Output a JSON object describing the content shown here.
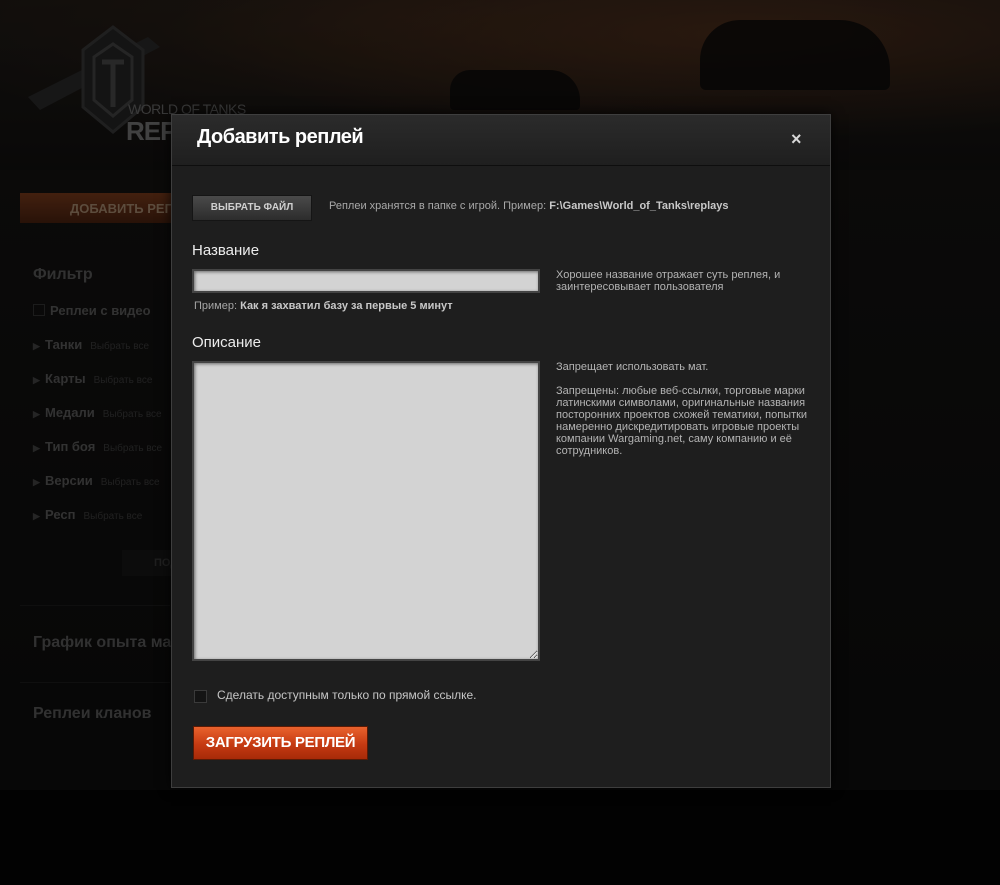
{
  "background": {
    "logo_text": "WORLD OF TANKS",
    "logo_subtitle": "REP",
    "sidebar": {
      "add_button": "ДОБАВИТЬ РЕПЛ",
      "filter_heading": "Фильтр",
      "video_filter": "Реплеи с видео",
      "filters": [
        {
          "label": "Танки",
          "hint": "Выбрать все"
        },
        {
          "label": "Карты",
          "hint": "Выбрать все"
        },
        {
          "label": "Медали",
          "hint": "Выбрать все"
        },
        {
          "label": "Тип боя",
          "hint": "Выбрать все"
        },
        {
          "label": "Версии",
          "hint": "Выбрать все"
        },
        {
          "label": "Респ",
          "hint": "Выбрать все"
        }
      ],
      "apply_button": "ПОД",
      "experience_heading": "График опыта масте",
      "clan_heading": "Реплеи кланов"
    }
  },
  "modal": {
    "title": "Добавить реплей",
    "close_glyph": "×",
    "choose_file_button": "ВЫБРАТЬ ФАЙЛ",
    "file_hint_prefix": "Реплеи хранятся в папке с игрой. Пример:",
    "file_hint_path": "F:\\Games\\World_of_Tanks\\replays",
    "name_label": "Название",
    "name_value": "",
    "name_help": "Хорошее название отражает суть реплея, и заинтересовывает пользователя",
    "example_prefix": "Пример:",
    "example_value": "Как я захватил базу за первые 5 минут",
    "description_label": "Описание",
    "description_value": "",
    "description_help_1": "Запрещает использовать мат.",
    "description_help_2": "Запрещены: любые веб-ссылки, торговые марки латинскими символами, оригинальные названия посторонних проектов схожей тематики, попытки намеренно дискредитировать игровые проекты компании Wargaming.net, саму компанию и её сотрудников.",
    "private_checkbox_label": "Сделать доступным только по прямой ссылке.",
    "private_checked": false,
    "upload_button": "ЗАГРУЗИТЬ РЕПЛЕЙ"
  },
  "colors": {
    "accent": "#c53a12",
    "modal_bg": "#1e1e1e",
    "input_bg": "#d3d3d3"
  }
}
